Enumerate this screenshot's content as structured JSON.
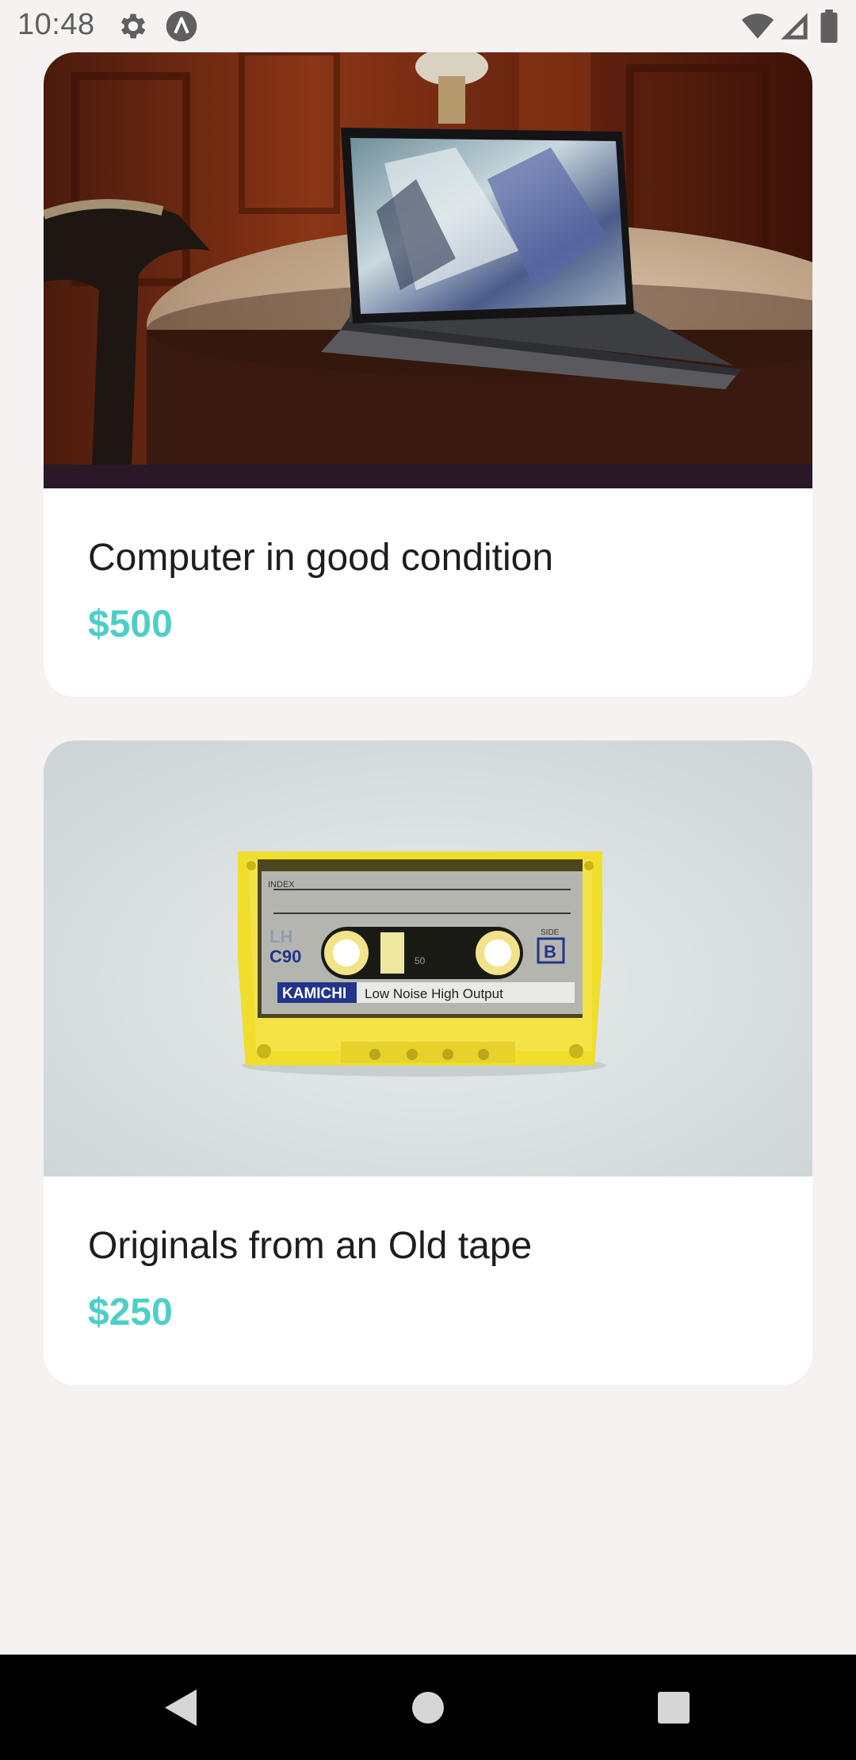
{
  "status_bar": {
    "time": "10:48",
    "left_icons": [
      "gear-icon",
      "app-a-icon"
    ],
    "right_icons": [
      "wifi-icon",
      "cellular-signal-icon",
      "battery-icon"
    ]
  },
  "listings": [
    {
      "image": "laptop-on-table-photo",
      "title": "Computer in good condition",
      "price": "$500"
    },
    {
      "image": "yellow-cassette-tape-photo",
      "title": "Originals from an Old tape",
      "price": "$250",
      "image_text": {
        "index": "INDEX",
        "lh": "LH",
        "c90": "C90",
        "side": "SIDE",
        "side_letter": "B",
        "brand": "KAMICHI",
        "tagline": "Low Noise High Output",
        "counter": "50"
      }
    }
  ],
  "navigation": {
    "back": "back-icon",
    "home": "home-icon",
    "recents": "recents-icon"
  },
  "colors": {
    "price": "#4dcfc7",
    "background": "#f6f2f2",
    "card": "#ffffff"
  }
}
